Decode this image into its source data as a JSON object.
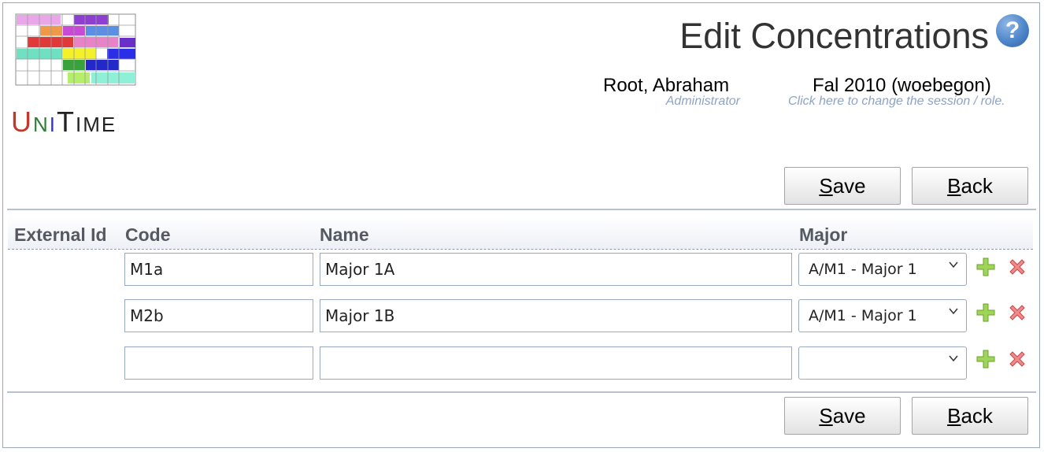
{
  "app": {
    "logo_text": [
      "U",
      "N",
      "I",
      "T",
      "I",
      "M",
      "E"
    ]
  },
  "header": {
    "title": "Edit Concentrations",
    "help_icon": "question-mark-icon",
    "user": {
      "name": "Root, Abraham",
      "role": "Administrator"
    },
    "session": {
      "name": "Fal 2010 (woebegon)",
      "hint": "Click here to change the session / role."
    }
  },
  "toolbar": {
    "save_label": "Save",
    "save_accesskey": "S",
    "back_label": "Back",
    "back_accesskey": "B"
  },
  "table": {
    "columns": [
      "External Id",
      "Code",
      "Name",
      "Major"
    ],
    "rows": [
      {
        "external_id": "",
        "code": "M1a",
        "name": "Major 1A",
        "major": "A/M1 - Major 1"
      },
      {
        "external_id": "",
        "code": "M2b",
        "name": "Major 1B",
        "major": "A/M1 - Major 1"
      },
      {
        "external_id": "",
        "code": "",
        "name": "",
        "major": ""
      }
    ],
    "row_icons": {
      "add": "plus-icon",
      "delete": "delete-x-icon"
    }
  },
  "colors": {
    "accent": "#4e86c9",
    "border": "#9aa9c2",
    "add": "#8cc63f",
    "delete": "#e06060"
  }
}
